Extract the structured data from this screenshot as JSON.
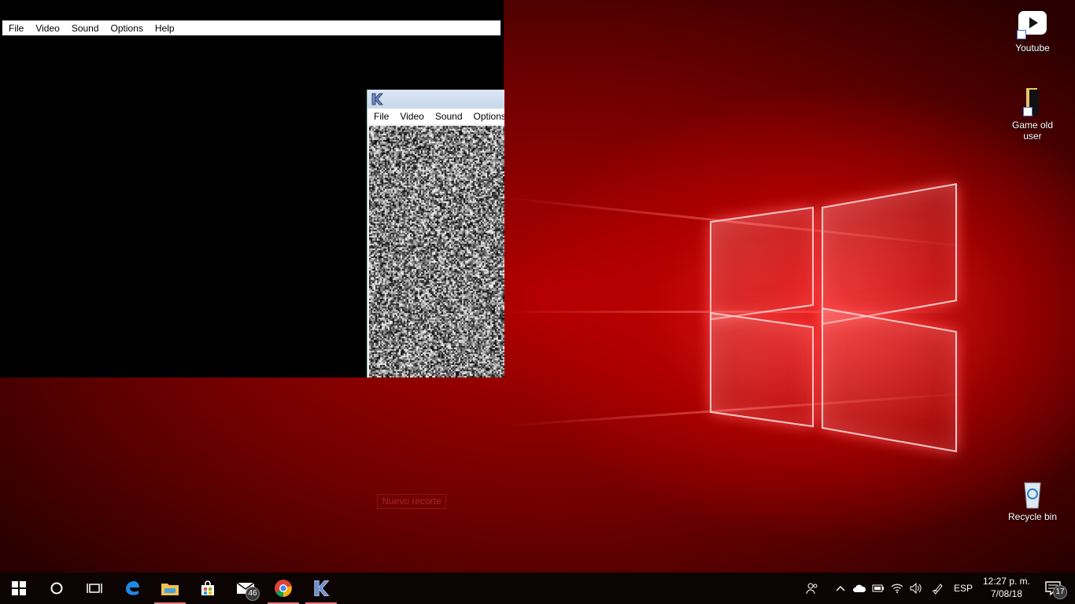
{
  "main_window": {
    "menu": [
      "File",
      "Video",
      "Sound",
      "Options",
      "Help"
    ]
  },
  "small_window": {
    "menu": [
      "File",
      "Video",
      "Sound",
      "Options"
    ]
  },
  "desktop_icons": [
    {
      "label": "Youtube",
      "icon": "youtube-icon"
    },
    {
      "label": "Game old user",
      "icon": "folder-icon"
    },
    {
      "label": "Recycle bin",
      "icon": "recycle-bin-icon"
    }
  ],
  "snip_label": "Nuevo recorte",
  "taskbar": {
    "mail_badge": "46",
    "notification_count": "17",
    "language": "ESP",
    "time": "12:27 p. m.",
    "date": "7/08/18"
  },
  "colors": {
    "taskbar_bg": "#0c0303",
    "accent_underline": "#e97a7a",
    "wallpaper_red": "#b30000"
  }
}
